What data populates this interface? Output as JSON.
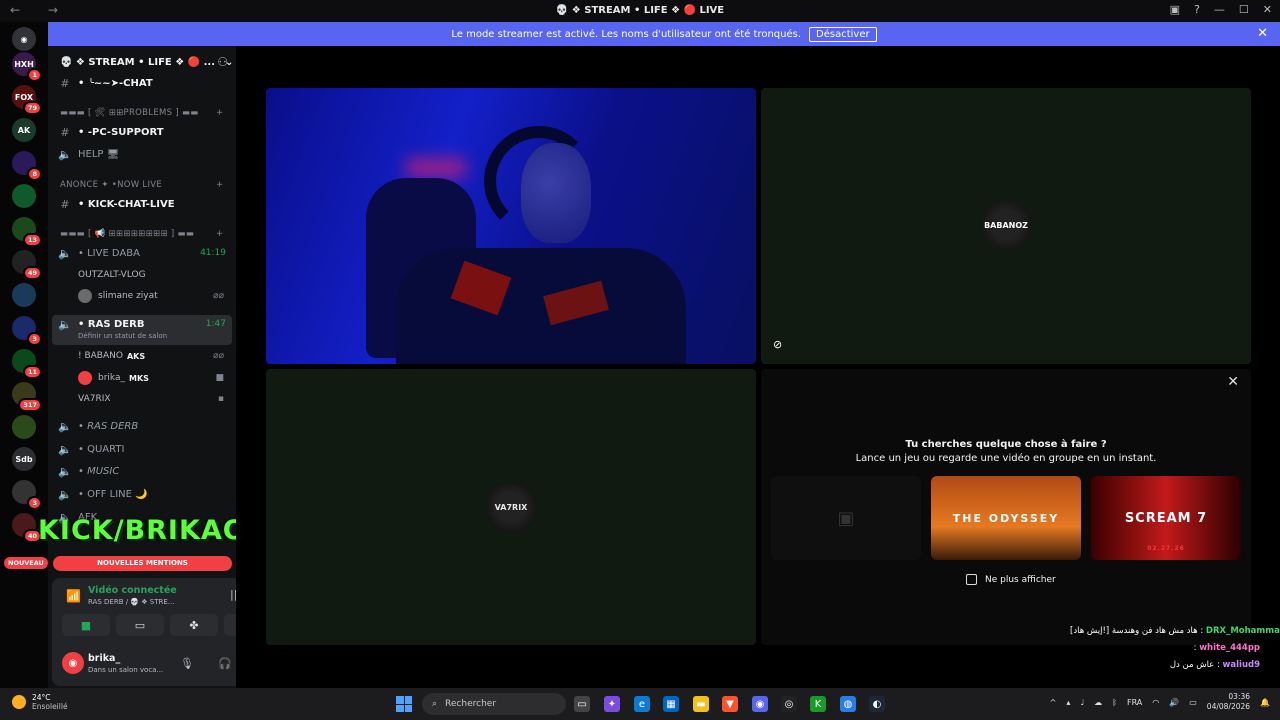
{
  "window": {
    "title": "💀 ❖ STREAM • LIFE ❖ 🔴 LIVE"
  },
  "banner": {
    "text": "Le mode streamer est activé. Les noms d'utilisateur ont été tronqués.",
    "button": "Désactiver"
  },
  "guilds": [
    {
      "label": "HXH",
      "badge": "1"
    },
    {
      "label": "FOX",
      "badge": "79"
    },
    {
      "label": "AK",
      "badge": ""
    },
    {
      "label": "",
      "badge": "8"
    },
    {
      "label": "",
      "badge": ""
    },
    {
      "label": "",
      "badge": "13"
    },
    {
      "label": "",
      "badge": "49"
    },
    {
      "label": "",
      "badge": ""
    },
    {
      "label": "",
      "badge": "3"
    },
    {
      "label": "",
      "badge": "11"
    },
    {
      "label": "",
      "badge": "317"
    },
    {
      "label": "",
      "badge": ""
    },
    {
      "label": "Sdb",
      "badge": ""
    },
    {
      "label": "",
      "badge": "3"
    },
    {
      "label": "",
      "badge": "40"
    }
  ],
  "server": {
    "name": "💀 ❖ STREAM • LIFE ❖ 🔴 ..."
  },
  "channels": {
    "chat": "• ╰~~➤-CHAT",
    "cat_problems": "▬▬▬ [ 🛠 ⊞⊞PROBLEMS ] ▬▬",
    "pc_support": "• -PC-SUPPORT",
    "help": "HELP 🖥",
    "cat_annonce": "ANONCE ✦ •NOW LIVE",
    "kick_chat": "• KICK-CHAT-LIVE",
    "cat_voice": "▬▬▬ [ 📢 ⊞⊞⊞⊞⊞⊞⊞⊞ ] ▬▬",
    "live_daba": "• LIVE DABA",
    "live_daba_time": "41:19",
    "outzalt": "OUTZALT-VLOG",
    "slimane": "slimane ziyat",
    "ras_derb": "• RAS DERB",
    "ras_derb_time": "1:47",
    "status_hint": "Définir un statut de salon",
    "babano": "! BABANO",
    "babano_tag": "AKS",
    "brika": "brika_",
    "brika_tag": "MKS",
    "va7rix": "VA7RIX",
    "ras_derb2": "• RAS DERB",
    "quarti": "• QUARTI",
    "music": "• MUSIC",
    "offline": "• OFF LINE 🌙",
    "afk": "AFK"
  },
  "overlay": {
    "kick": "KICK/BRIKAO",
    "nouveau": "NOUVEAU",
    "mentions": "NOUVELLES MENTIONS"
  },
  "voice": {
    "status": "Vidéo connectée",
    "sub": "RAS DERB / 💀 ❖ STRE..."
  },
  "user": {
    "name": "brika_",
    "status": "Dans un salon voca..."
  },
  "tiles": {
    "babanoz": "BABANOZ",
    "va7rix": "VA7RIX"
  },
  "activity": {
    "title": "Tu cherches quelque chose à faire ?",
    "subtitle": "Lance un jeu ou regarde une vidéo en groupe en un instant.",
    "card2": "THE ODYSSEY",
    "card3": "SCREAM 7",
    "card3_date": "02.27.26",
    "checkbox": "Ne plus afficher"
  },
  "chat_overlay": [
    {
      "user": "DRX_Mohammad",
      "msg": "[إيش هاد!] هاد مش هاد فن وهندسة :"
    },
    {
      "user": "white_444pp",
      "msg": ":"
    },
    {
      "user": "waliud9",
      "msg": "عاش من دل :"
    }
  ],
  "taskbar": {
    "temp": "24°C",
    "weather": "Ensoleillé",
    "search": "Rechercher",
    "lang": "FRA",
    "time": "03:36",
    "date": "04/08/2026"
  }
}
